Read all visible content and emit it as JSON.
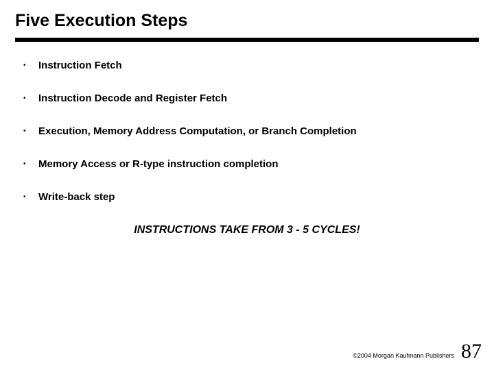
{
  "title": "Five Execution Steps",
  "bullets": [
    "Instruction Fetch",
    "Instruction Decode and Register Fetch",
    "Execution, Memory Address Computation, or Branch Completion",
    "Memory Access or R-type instruction completion",
    "Write-back step"
  ],
  "callout": "INSTRUCTIONS TAKE FROM 3 - 5 CYCLES!",
  "footer": {
    "copyright": "©2004 Morgan Kaufmann Publishers",
    "page": "87"
  }
}
